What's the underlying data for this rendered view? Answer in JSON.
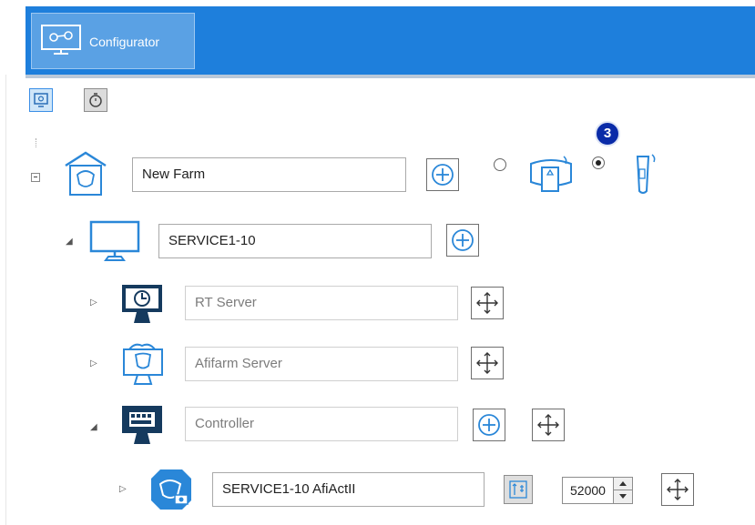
{
  "app": {
    "tab_label": "Configurator"
  },
  "toolbar": {
    "buttons": [
      {
        "icon": "monitor-settings-icon",
        "state": "selected"
      },
      {
        "icon": "stopwatch-icon",
        "state": "normal"
      }
    ]
  },
  "step_badge": "3",
  "farm": {
    "name": "New Farm",
    "tag_options": [
      {
        "icon": "collar-tag-icon",
        "selected": false
      },
      {
        "icon": "leg-tag-icon",
        "selected": true
      }
    ]
  },
  "tree": {
    "computer": {
      "name": "SERVICE1-10"
    },
    "rt_server": {
      "name": "RT Server"
    },
    "afifarm_server": {
      "name": "Afifarm Server"
    },
    "controller": {
      "name": "Controller"
    },
    "device": {
      "name": "SERVICE1-10 AfiActII",
      "port": "52000"
    }
  },
  "colors": {
    "accent": "#1e7fdc",
    "icon_blue": "#2a87d8"
  }
}
